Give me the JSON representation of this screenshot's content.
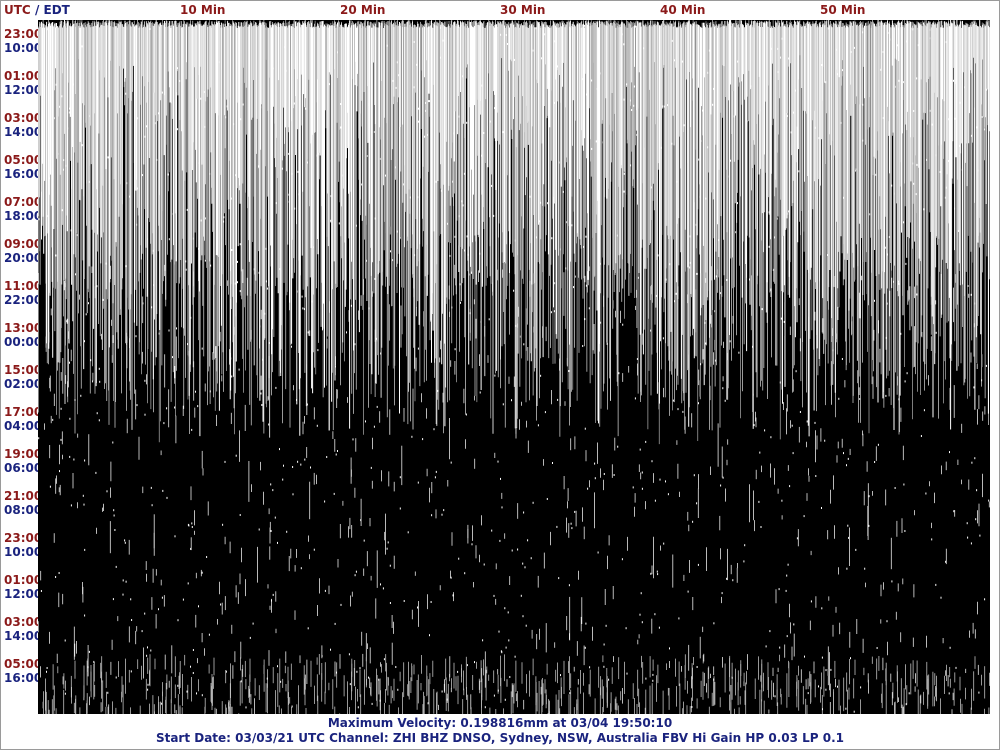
{
  "header": {
    "utc_label": "UTC",
    "separator": "/",
    "local_label": "EDT"
  },
  "minute_labels": [
    "10 Min",
    "20 Min",
    "30 Min",
    "40 Min",
    "50 Min"
  ],
  "row_labels": [
    {
      "utc": "23:00",
      "local": "10:00"
    },
    {
      "utc": "01:00",
      "local": "12:00"
    },
    {
      "utc": "03:00",
      "local": "14:00"
    },
    {
      "utc": "05:00",
      "local": "16:00"
    },
    {
      "utc": "07:00",
      "local": "18:00"
    },
    {
      "utc": "09:00",
      "local": "20:00"
    },
    {
      "utc": "11:00",
      "local": "22:00"
    },
    {
      "utc": "13:00",
      "local": "00:00"
    },
    {
      "utc": "15:00",
      "local": "02:00"
    },
    {
      "utc": "17:00",
      "local": "04:00"
    },
    {
      "utc": "19:00",
      "local": "06:00"
    },
    {
      "utc": "21:00",
      "local": "08:00"
    },
    {
      "utc": "23:00",
      "local": "10:00"
    },
    {
      "utc": "01:00",
      "local": "12:00"
    },
    {
      "utc": "03:00",
      "local": "14:00"
    },
    {
      "utc": "05:00",
      "local": "16:00"
    }
  ],
  "footer": {
    "max_velocity": "Maximum Velocity: 0.198816mm at 03/04 19:50:10",
    "start_info": "Start Date: 03/03/21 UTC Channel: ZHI  BHZ  DNSO, Sydney, NSW, Australia  FBV Hi Gain HP 0.03  LP 0.1"
  },
  "colors": {
    "utc_text": "#8b1a1a",
    "local_text": "#1a237e",
    "trace": "#ffffff",
    "background": "#000000"
  },
  "chart_data": {
    "type": "heatmap",
    "title": "",
    "subtitle": "",
    "x_axis": "Min",
    "x_ticks": [
      10,
      20,
      30,
      40,
      50
    ],
    "xlim": [
      0,
      60
    ],
    "rows": 50,
    "description_rows_per_hour": 1,
    "saturation": "heavy saturation in upper rows, sparse spikes in lower rows"
  }
}
